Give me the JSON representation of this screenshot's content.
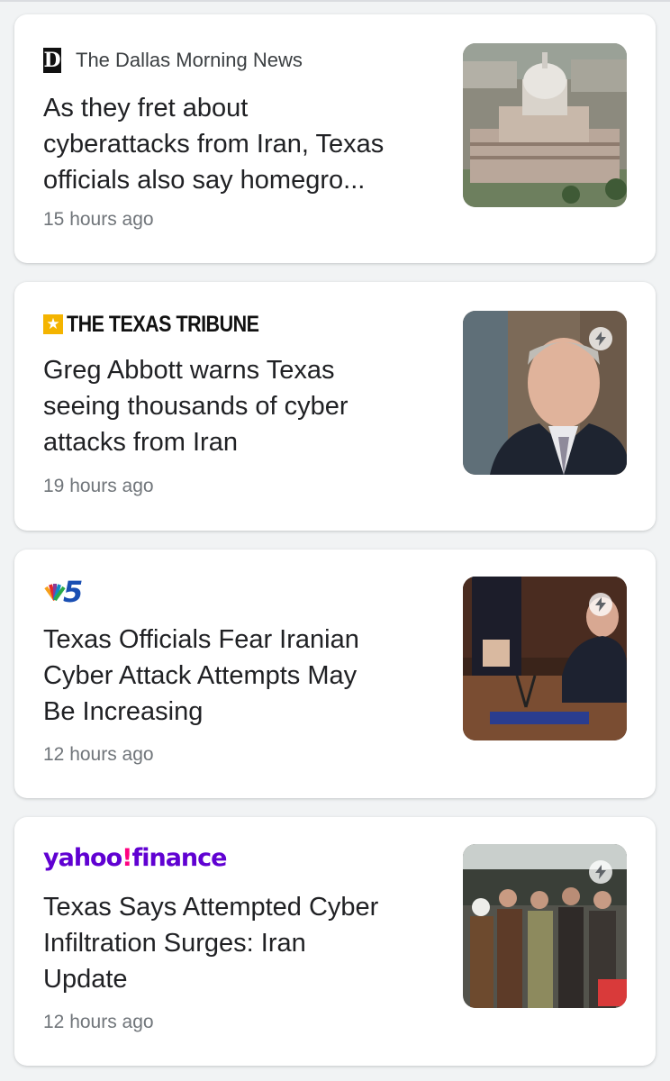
{
  "articles": [
    {
      "source": "The Dallas Morning News",
      "source_logo_letter": "D",
      "source_icon": "dallas-morning-news-logo",
      "title_lines": [
        "As they fret about",
        "cyberattacks from Iran, Texas",
        "officials also say homegro..."
      ],
      "time": "15 hours ago",
      "thumbnail": "texas-capitol-building-aerial",
      "amp": false
    },
    {
      "source": "THE TEXAS TRIBUNE",
      "source_icon": "texas-tribune-star-logo",
      "title_lines": [
        "Greg Abbott warns Texas",
        "seeing thousands of cyber",
        "attacks from Iran"
      ],
      "time": "19 hours ago",
      "thumbnail": "greg-abbott-portrait",
      "amp": true
    },
    {
      "source_logo_text": "5",
      "source_icon": "nbc5-peacock-logo",
      "title_lines": [
        "Texas Officials Fear Iranian",
        "Cyber Attack Attempts May",
        "Be Increasing"
      ],
      "time": "12 hours ago",
      "thumbnail": "press-conference-podium",
      "amp": true
    },
    {
      "source_part1": "yahoo",
      "source_part2": "!",
      "source_part3": "finance",
      "source_icon": "yahoo-finance-logo",
      "title_lines": [
        "Texas Says Attempted Cyber",
        "Infiltration Surges: Iran",
        "Update"
      ],
      "time": "12 hours ago",
      "thumbnail": "crowd-gathering",
      "amp": true
    }
  ],
  "colors": {
    "background": "#f1f3f4",
    "card": "#ffffff",
    "title_text": "#202124",
    "meta_text": "#70757a",
    "tribune_star": "#f4b400",
    "yahoo_purple": "#6001d2",
    "yahoo_pink": "#ff0080"
  }
}
